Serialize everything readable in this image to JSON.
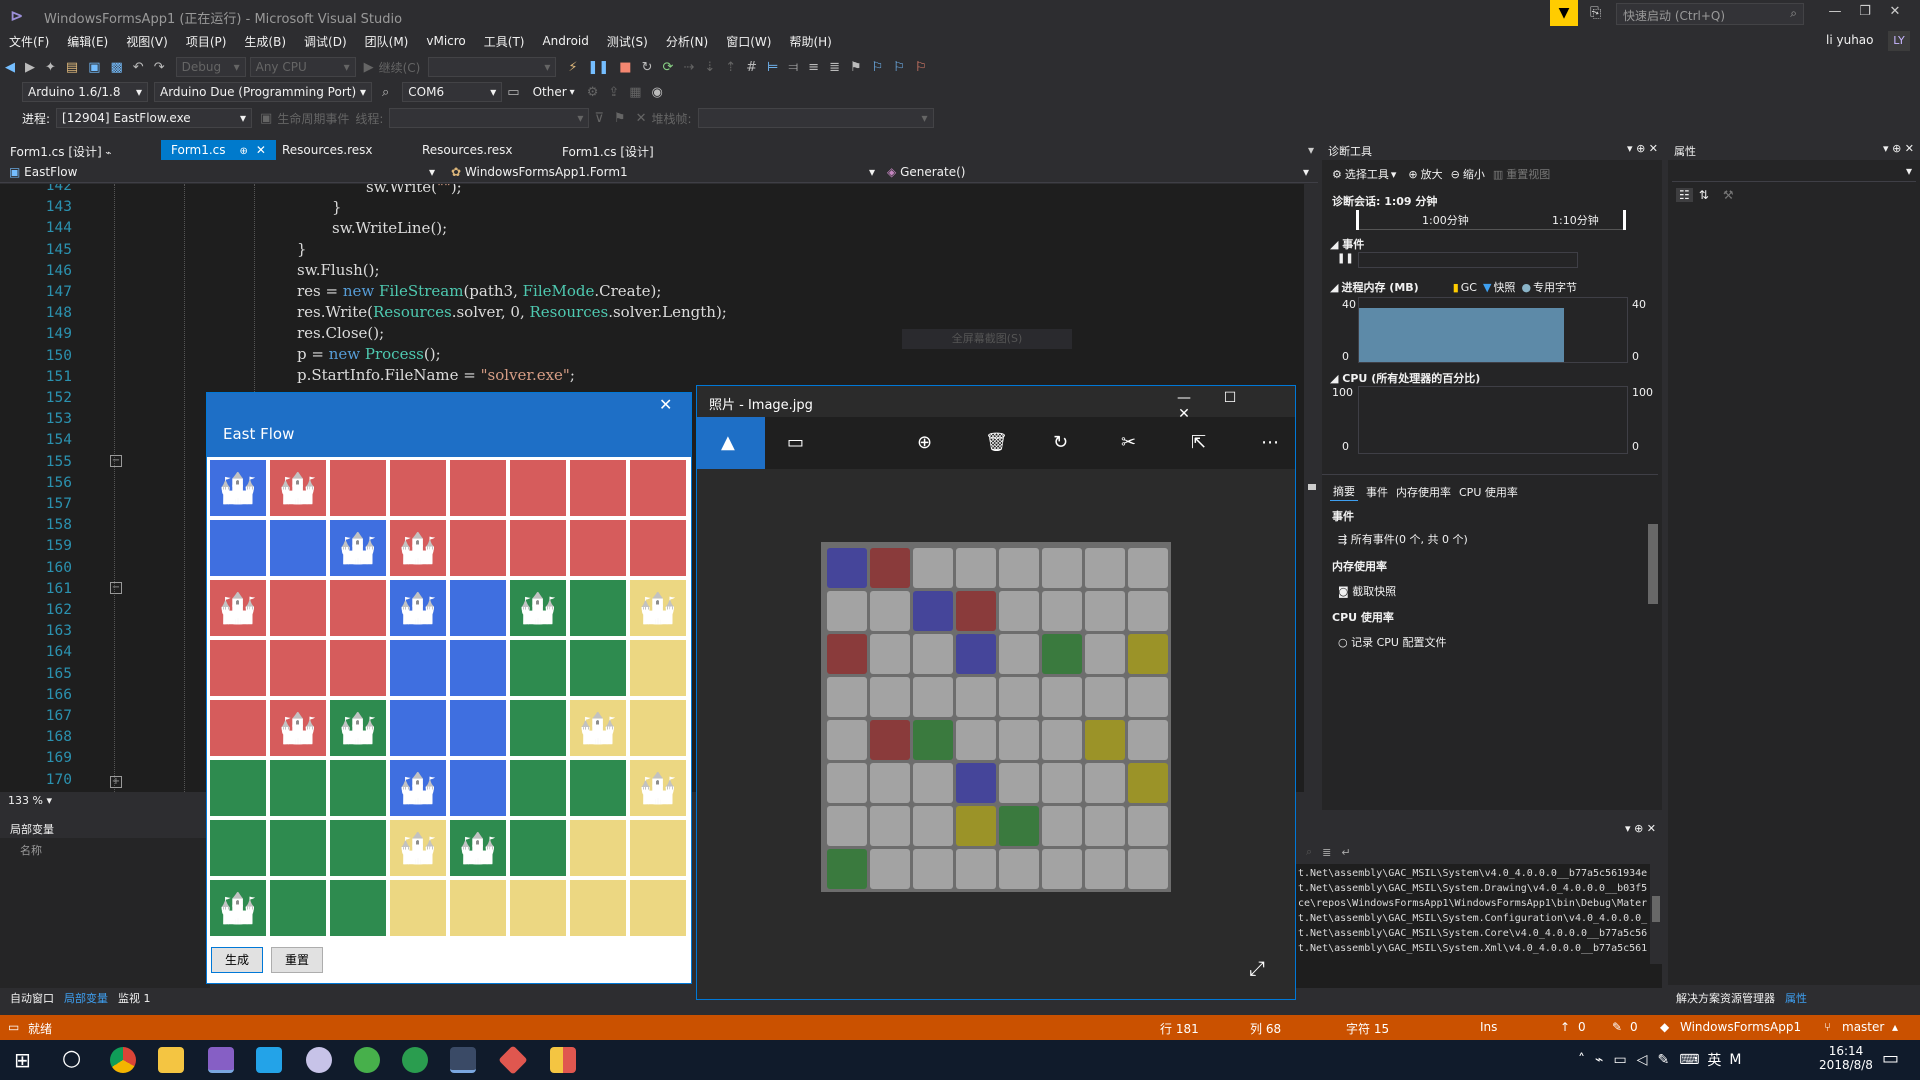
{
  "window": {
    "title": "WindowsFormsApp1 (正在运行) - Microsoft Visual Studio",
    "quick_launch": "快速启动 (Ctrl+Q)",
    "user": "li yuhao",
    "user_initials": "LY"
  },
  "menu": [
    "文件(F)",
    "编辑(E)",
    "视图(V)",
    "项目(P)",
    "生成(B)",
    "调试(D)",
    "团队(M)",
    "vMicro",
    "工具(T)",
    "Android",
    "测试(S)",
    "分析(N)",
    "窗口(W)",
    "帮助(H)"
  ],
  "toolbar1": {
    "config": "Debug",
    "platform": "Any CPU",
    "continue": "继续(C)"
  },
  "toolbar2": {
    "board": "Arduino 1.6/1.8",
    "board_model": "Arduino Due (Programming Port)",
    "port": "COM6",
    "other": "Other"
  },
  "toolbar3": {
    "process_label": "进程:",
    "process": "[12904] EastFlow.exe",
    "lifecycle": "生命周期事件",
    "thread": "线程:",
    "stack": "堆栈帧:"
  },
  "tabs": [
    {
      "label": "Form1.cs [设计]",
      "active": false
    },
    {
      "label": "Form1.cs",
      "active": true
    },
    {
      "label": "Resources.resx",
      "active": false
    },
    {
      "label": "Resources.resx",
      "active": false
    },
    {
      "label": "Form1.cs [设计]",
      "active": false
    }
  ],
  "nav": {
    "project": "EastFlow",
    "class": "WindowsFormsApp1.Form1",
    "member": "Generate()"
  },
  "editor": {
    "line_numbers": [
      "142",
      "143",
      "144",
      "145",
      "146",
      "147",
      "148",
      "149",
      "150",
      "151",
      "152",
      "153",
      "154",
      "155",
      "156",
      "157",
      "158",
      "159",
      "160",
      "161",
      "162",
      "163",
      "164",
      "165",
      "166",
      "167",
      "168",
      "169",
      "170"
    ],
    "zoom": "133 %"
  },
  "locals": {
    "title": "局部变量",
    "col_name": "名称"
  },
  "bottom_tabs": [
    "自动窗口",
    "局部变量",
    "监视 1"
  ],
  "eastflow": {
    "title": "East Flow",
    "generate": "生成",
    "reset": "重置",
    "colors": {
      "R": "#d65c5c",
      "B": "#3f6fe0",
      "G": "#2e8b4f",
      "Y": "#ecd782"
    },
    "grid": [
      [
        "B*",
        "R*",
        "R",
        "R",
        "R",
        "R",
        "R",
        "R"
      ],
      [
        "B",
        "B",
        "B*",
        "R*",
        "R",
        "R",
        "R",
        "R"
      ],
      [
        "R*",
        "R",
        "R",
        "B*",
        "B",
        "G*",
        "G",
        "Y*"
      ],
      [
        "R",
        "R",
        "R",
        "B",
        "B",
        "G",
        "G",
        "Y"
      ],
      [
        "R",
        "R*",
        "G*",
        "B",
        "B",
        "G",
        "Y*",
        "Y"
      ],
      [
        "G",
        "G",
        "G",
        "B*",
        "B",
        "G",
        "G",
        "Y*"
      ],
      [
        "G",
        "G",
        "G",
        "Y*",
        "G*",
        "G",
        "Y",
        "Y"
      ],
      [
        "G*",
        "G",
        "G",
        "Y",
        "Y",
        "Y",
        "Y",
        "Y"
      ]
    ]
  },
  "photos": {
    "title": "照片 - Image.jpg",
    "photo_grid": [
      [
        "B",
        "R",
        "g",
        "g",
        "g",
        "g",
        "g",
        "g"
      ],
      [
        "g",
        "g",
        "B",
        "R",
        "g",
        "g",
        "g",
        "g"
      ],
      [
        "R",
        "g",
        "g",
        "B",
        "g",
        "G",
        "g",
        "Y"
      ],
      [
        "g",
        "g",
        "g",
        "g",
        "g",
        "g",
        "g",
        "g"
      ],
      [
        "g",
        "R",
        "G",
        "g",
        "g",
        "g",
        "Y",
        "g"
      ],
      [
        "g",
        "g",
        "g",
        "B",
        "g",
        "g",
        "g",
        "Y"
      ],
      [
        "g",
        "g",
        "g",
        "Y",
        "G",
        "g",
        "g",
        "g"
      ],
      [
        "G",
        "g",
        "g",
        "g",
        "g",
        "g",
        "g",
        "g"
      ]
    ],
    "photo_colors": {
      "B": "#45459a",
      "R": "#8a3b3b",
      "G": "#3a7a3e",
      "Y": "#9b9328",
      "g": "#a3a3a3"
    }
  },
  "diag": {
    "title": "诊断工具",
    "select_tool": "选择工具",
    "zoom_in": "放大",
    "zoom_out": "缩小",
    "reset_view": "重置视图",
    "session": "诊断会话: 1:09 分钟",
    "t1": "1:00分钟",
    "t2": "1:10分钟",
    "events": "事件",
    "memory": "进程内存 (MB)",
    "gc": "GC",
    "snapshot": "快照",
    "private": "专用字节",
    "mem_max": "40",
    "mem_min": "0",
    "cpu": "CPU (所有处理器的百分比)",
    "cpu_max": "100",
    "cpu_min": "0",
    "sub_tabs": [
      "摘要",
      "事件",
      "内存使用率",
      "CPU 使用率"
    ],
    "sec_events": "事件",
    "all_events": "所有事件(0 个, 共 0 个)",
    "sec_mem": "内存使用率",
    "take_snapshot": "截取快照",
    "sec_cpu": "CPU 使用率",
    "record_cpu": "记录 CPU 配置文件",
    "mem_fill_fraction": 0.85
  },
  "props": {
    "title": "属性",
    "tab_solution": "解决方案资源管理器",
    "tab_props": "属性"
  },
  "output": {
    "lines": [
      "t.Net\\assembly\\GAC_MSIL\\System\\v4.0_4.0.0.0__b77a5c561934e",
      "t.Net\\assembly\\GAC_MSIL\\System.Drawing\\v4.0_4.0.0.0__b03f5",
      "ce\\repos\\WindowsFormsApp1\\WindowsFormsApp1\\bin\\Debug\\Mater",
      "t.Net\\assembly\\GAC_MSIL\\System.Configuration\\v4.0_4.0.0.0_",
      "t.Net\\assembly\\GAC_MSIL\\System.Core\\v4.0_4.0.0.0__b77a5c56",
      "t.Net\\assembly\\GAC_MSIL\\System.Xml\\v4.0_4.0.0.0__b77a5c561"
    ]
  },
  "status": {
    "ready": "就绪",
    "row": "行 181",
    "col": "列 68",
    "char": "字符 15",
    "ins": "Ins",
    "up": "0",
    "edits": "0",
    "repo": "WindowsFormsApp1",
    "branch": "master"
  },
  "taskbar": {
    "time": "16:14",
    "date": "2018/8/8",
    "ime1": "英",
    "ime2": "M"
  },
  "watermark": "全屏幕截图(S)"
}
